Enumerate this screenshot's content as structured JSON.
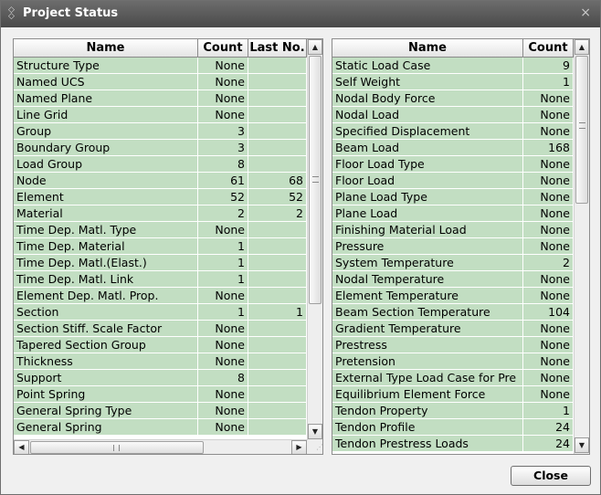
{
  "window": {
    "title": "Project Status",
    "close_glyph": "×",
    "title_icon": "restore-icon"
  },
  "left_table": {
    "columns": [
      "Name",
      "Count",
      "Last No."
    ],
    "rows": [
      [
        "Structure Type",
        "None",
        ""
      ],
      [
        "Named UCS",
        "None",
        ""
      ],
      [
        "Named Plane",
        "None",
        ""
      ],
      [
        "Line Grid",
        "None",
        ""
      ],
      [
        "Group",
        "3",
        ""
      ],
      [
        "Boundary Group",
        "3",
        ""
      ],
      [
        "Load Group",
        "8",
        ""
      ],
      [
        "Node",
        "61",
        "68"
      ],
      [
        "Element",
        "52",
        "52"
      ],
      [
        "Material",
        "2",
        "2"
      ],
      [
        "Time Dep. Matl. Type",
        "None",
        ""
      ],
      [
        "Time Dep. Material",
        "1",
        ""
      ],
      [
        "Time Dep. Matl.(Elast.)",
        "1",
        ""
      ],
      [
        "Time Dep. Matl. Link",
        "1",
        ""
      ],
      [
        "Element Dep. Matl. Prop.",
        "None",
        ""
      ],
      [
        "Section",
        "1",
        "1"
      ],
      [
        "Section Stiff. Scale Factor",
        "None",
        ""
      ],
      [
        "Tapered Section Group",
        "None",
        ""
      ],
      [
        "Thickness",
        "None",
        ""
      ],
      [
        "Support",
        "8",
        ""
      ],
      [
        "Point Spring",
        "None",
        ""
      ],
      [
        "General Spring Type",
        "None",
        ""
      ],
      [
        "General Spring",
        "None",
        ""
      ]
    ]
  },
  "right_table": {
    "columns": [
      "Name",
      "Count"
    ],
    "rows": [
      [
        "Static Load Case",
        "9"
      ],
      [
        "Self Weight",
        "1"
      ],
      [
        "Nodal Body Force",
        "None"
      ],
      [
        "Nodal Load",
        "None"
      ],
      [
        "Specified Displacement",
        "None"
      ],
      [
        "Beam Load",
        "168"
      ],
      [
        "Floor Load Type",
        "None"
      ],
      [
        "Floor Load",
        "None"
      ],
      [
        "Plane Load Type",
        "None"
      ],
      [
        "Plane Load",
        "None"
      ],
      [
        "Finishing Material Load",
        "None"
      ],
      [
        "Pressure",
        "None"
      ],
      [
        "System Temperature",
        "2"
      ],
      [
        "Nodal Temperature",
        "None"
      ],
      [
        "Element Temperature",
        "None"
      ],
      [
        "Beam Section Temperature",
        "104"
      ],
      [
        "Gradient Temperature",
        "None"
      ],
      [
        "Prestress",
        "None"
      ],
      [
        "Pretension",
        "None"
      ],
      [
        "External Type Load Case for Pre",
        "None"
      ],
      [
        "Equilibrium Element Force",
        "None"
      ],
      [
        "Tendon Property",
        "1"
      ],
      [
        "Tendon Profile",
        "24"
      ],
      [
        "Tendon Prestress Loads",
        "24"
      ]
    ]
  },
  "footer": {
    "close_label": "Close"
  }
}
